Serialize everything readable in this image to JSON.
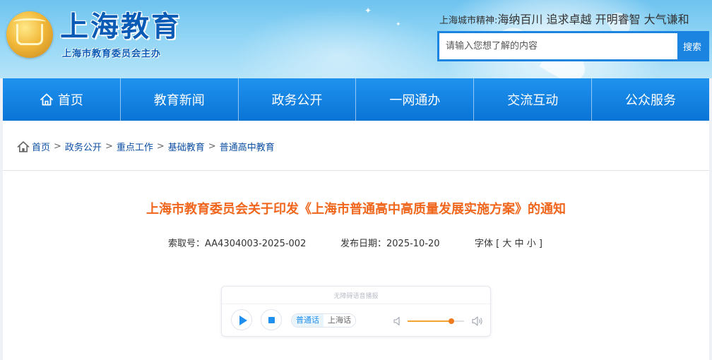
{
  "header": {
    "site_title": "上海教育",
    "site_subtitle": "上海市教育委员会主办",
    "spirit_label": "上海城市精神:",
    "spirit_value": "海纳百川 追求卓越 开明睿智 大气谦和",
    "search_placeholder": "请输入您想了解的内容",
    "search_button": "搜索"
  },
  "nav": {
    "items": [
      {
        "label": "首页",
        "icon": "home-icon"
      },
      {
        "label": "教育新闻"
      },
      {
        "label": "政务公开"
      },
      {
        "label": "一网通办"
      },
      {
        "label": "交流互动"
      },
      {
        "label": "公众服务"
      }
    ]
  },
  "breadcrumb": {
    "icon": "home-icon",
    "separator": ">",
    "items": [
      "首页",
      "政务公开",
      "重点工作",
      "基础教育",
      "普通高中教育"
    ]
  },
  "article": {
    "title": "上海市教育委员会关于印发《上海市普通高中高质量发展实施方案》的通知",
    "index_label": "索取号：",
    "index_value": "AA4304003-2025-002",
    "date_label": "发布日期：",
    "date_value": "2025-10-20",
    "font_label": "字体",
    "font_open": "[",
    "font_large": "大",
    "font_medium": "中",
    "font_small": "小",
    "font_close": "]"
  },
  "player": {
    "caption": "无障碍语音播报",
    "lang_mandarin": "普通话",
    "lang_shanghainese": "上海话",
    "volume_level": 0.78,
    "accent_color": "#1f8ff0",
    "volume_color": "#f07a1c"
  },
  "colors": {
    "nav_blue": "#0a74d6",
    "title_orange": "#f0661c",
    "link_blue": "#0c4fa3"
  }
}
